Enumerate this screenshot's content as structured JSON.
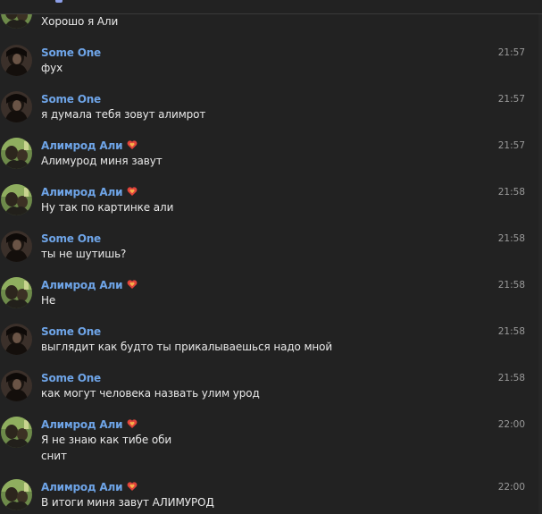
{
  "colors": {
    "background": "#222222",
    "author_name": "#6ea4e7",
    "message_text": "#e9e9e9",
    "timestamp": "#9a9a9a",
    "heart_badge": "#e0433b"
  },
  "icons": {
    "author_badge": "heart-icon"
  },
  "messages": [
    {
      "author": "",
      "time": "",
      "text": "Хорошо я Али",
      "text2": "",
      "badge": false,
      "avatar": "alimrod"
    },
    {
      "author": "Some One",
      "time": "21:57",
      "text": "фух",
      "text2": "",
      "badge": false,
      "avatar": "someone"
    },
    {
      "author": "Some One",
      "time": "21:57",
      "text": "я думала тебя зовут алимрот",
      "text2": "",
      "badge": false,
      "avatar": "someone"
    },
    {
      "author": "Алимрод Али",
      "time": "21:57",
      "text": "Алимурод миня завут",
      "text2": "",
      "badge": true,
      "avatar": "alimrod"
    },
    {
      "author": "Алимрод Али",
      "time": "21:58",
      "text": "Ну так по картинке али",
      "text2": "",
      "badge": true,
      "avatar": "alimrod"
    },
    {
      "author": "Some One",
      "time": "21:58",
      "text": "ты не шутишь?",
      "text2": "",
      "badge": false,
      "avatar": "someone"
    },
    {
      "author": "Алимрод Али",
      "time": "21:58",
      "text": "Не",
      "text2": "",
      "badge": true,
      "avatar": "alimrod"
    },
    {
      "author": "Some One",
      "time": "21:58",
      "text": "выглядит как будто ты прикалываешься надо мной",
      "text2": "",
      "badge": false,
      "avatar": "someone"
    },
    {
      "author": "Some One",
      "time": "21:58",
      "text": "как могут человека назвать улим урод",
      "text2": "",
      "badge": false,
      "avatar": "someone"
    },
    {
      "author": "Алимрод Али",
      "time": "22:00",
      "text": "Я не знаю как тибе оби",
      "text2": "снит",
      "badge": true,
      "avatar": "alimrod"
    },
    {
      "author": "Алимрод Али",
      "time": "22:00",
      "text": "В итоги миня завут АЛИМУРОД",
      "text2": "",
      "badge": true,
      "avatar": "alimrod"
    }
  ]
}
